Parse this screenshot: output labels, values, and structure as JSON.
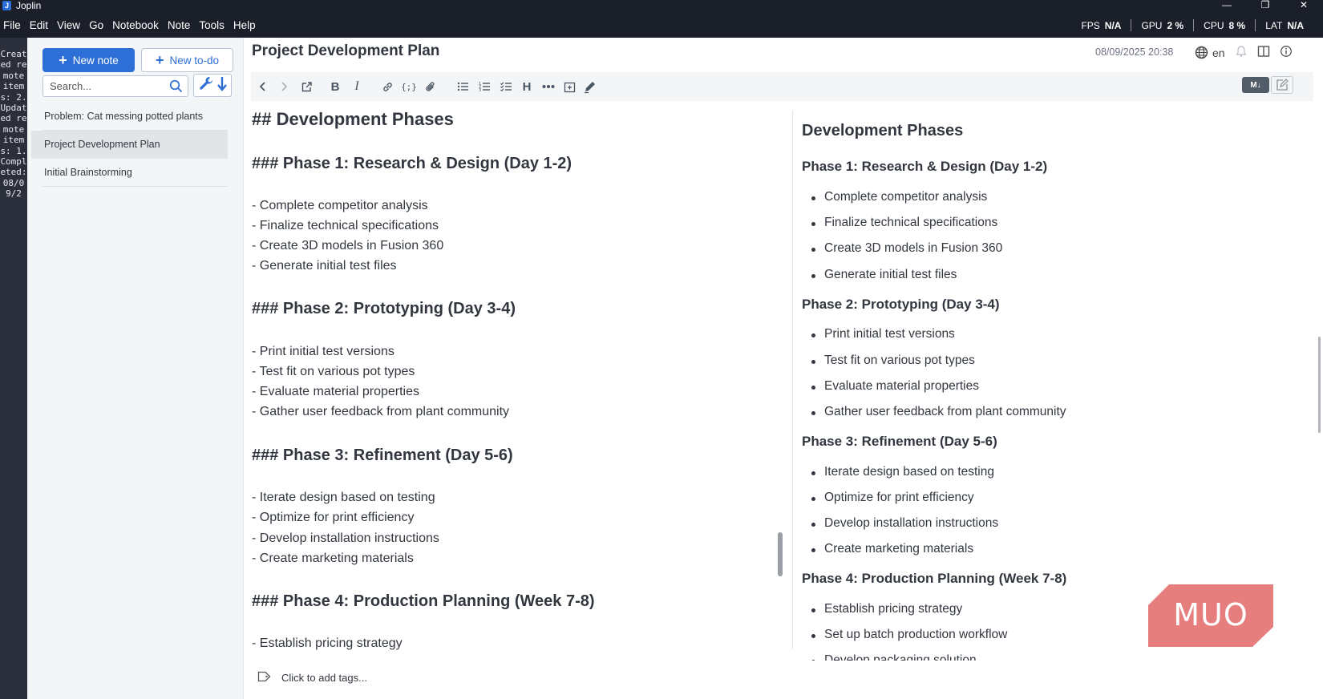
{
  "window": {
    "title": "Joplin",
    "controls": [
      "—",
      "❐",
      "✕"
    ]
  },
  "menu": [
    "File",
    "Edit",
    "View",
    "Go",
    "Notebook",
    "Note",
    "Tools",
    "Help"
  ],
  "perf": [
    {
      "label": "FPS",
      "value": "N/A"
    },
    {
      "label": "GPU",
      "value": "2 %"
    },
    {
      "label": "CPU",
      "value": "8 %"
    },
    {
      "label": "LAT",
      "value": "N/A"
    }
  ],
  "sync_status": "Created remote items: 2. Updated remote items: 1. Completed: 08/09/2",
  "notelist": {
    "new_note_label": "New note",
    "new_todo_label": "New to-do",
    "search_placeholder": "Search...",
    "notes": [
      {
        "title": "Problem: Cat messing potted plants",
        "selected": false
      },
      {
        "title": "Project Development Plan",
        "selected": true
      },
      {
        "title": "Initial Brainstorming",
        "selected": false
      }
    ]
  },
  "editor": {
    "title": "Project Development Plan",
    "date": "08/09/2025 20:38",
    "language": "en",
    "toggle_label": "M↓",
    "tags_label": "Click to add tags..."
  },
  "markdown": {
    "h2": "## Development Phases",
    "phases": [
      {
        "heading": "### Phase 1: Research & Design (Day 1-2)",
        "items": [
          "- Complete competitor analysis",
          "- Finalize technical specifications",
          "- Create 3D models in Fusion 360",
          "- Generate initial test files"
        ]
      },
      {
        "heading": "### Phase 2: Prototyping (Day 3-4)",
        "items": [
          "- Print initial test versions",
          "- Test fit on various pot types",
          "- Evaluate material properties",
          "- Gather user feedback from plant community"
        ]
      },
      {
        "heading": "### Phase 3: Refinement (Day 5-6)",
        "items": [
          "- Iterate design based on testing",
          "- Optimize for print efficiency",
          "- Develop installation instructions",
          "- Create marketing materials"
        ]
      },
      {
        "heading": "### Phase 4: Production Planning (Week 7-8)",
        "items": [
          "- Establish pricing strategy"
        ]
      }
    ]
  },
  "preview": {
    "h2": "Development Phases",
    "phases": [
      {
        "heading": "Phase 1: Research & Design (Day 1-2)",
        "items": [
          "Complete competitor analysis",
          "Finalize technical specifications",
          "Create 3D models in Fusion 360",
          "Generate initial test files"
        ]
      },
      {
        "heading": "Phase 2: Prototyping (Day 3-4)",
        "items": [
          "Print initial test versions",
          "Test fit on various pot types",
          "Evaluate material properties",
          "Gather user feedback from plant community"
        ]
      },
      {
        "heading": "Phase 3: Refinement (Day 5-6)",
        "items": [
          "Iterate design based on testing",
          "Optimize for print efficiency",
          "Develop installation instructions",
          "Create marketing materials"
        ]
      },
      {
        "heading": "Phase 4: Production Planning (Week 7-8)",
        "items": [
          "Establish pricing strategy",
          "Set up batch production workflow",
          "Develop packaging solution"
        ]
      }
    ]
  },
  "watermark": {
    "text": "MUO",
    "color": "#e57373"
  },
  "colors": {
    "accent": "#2d6fd6",
    "dark": "#1b1f2a",
    "strip": "#2b2f3b"
  }
}
